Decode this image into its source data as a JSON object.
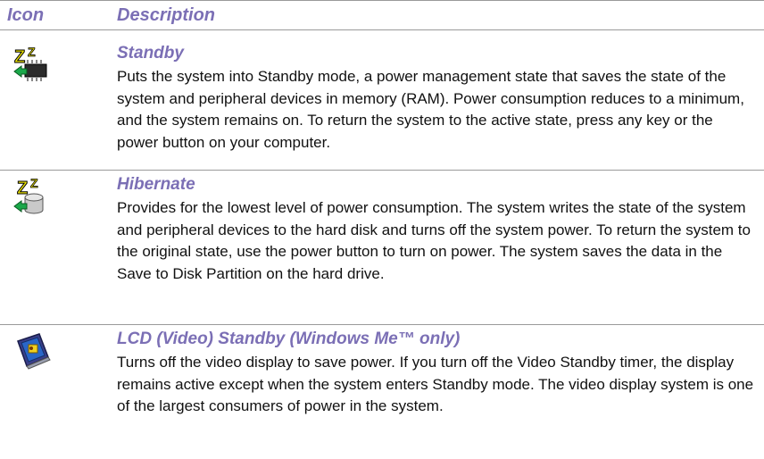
{
  "header": {
    "icon_label": "Icon",
    "description_label": "Description"
  },
  "rows": [
    {
      "icon": "standby-chip-icon",
      "title": "Standby",
      "text": "Puts the system into Standby mode, a power management state that saves the state of the system and peripheral devices in memory (RAM). Power consumption reduces to a minimum, and the system remains on. To return the system to the active state, press any key or the power button on your computer."
    },
    {
      "icon": "hibernate-disk-icon",
      "title": "Hibernate",
      "text": "Provides for the lowest level of power consumption. The system writes the state of the system and peripheral devices to the hard disk and turns off the system power. To return the system to the original state, use the power button to turn on power. The system saves the data in the Save to Disk Partition on the hard drive."
    },
    {
      "icon": "lcd-monitor-icon",
      "title": "LCD (Video) Standby (Windows Me™ only)",
      "text": "Turns off the video display to save power. If you turn off the Video Standby timer, the display remains active except when the system enters Standby mode. The video display system is one of the largest consumers of power in the system."
    }
  ],
  "colors": {
    "heading": "#7b6fb5",
    "rule": "#9a9a9a",
    "text": "#111111"
  }
}
